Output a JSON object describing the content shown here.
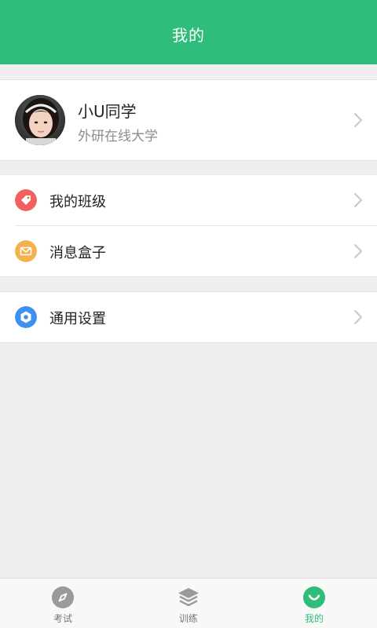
{
  "header": {
    "title": "我的"
  },
  "profile": {
    "name": "小U同学",
    "school": "外研在线大学"
  },
  "menu": {
    "items": [
      {
        "label": "我的班级",
        "icon": "tag-icon",
        "color": "#f0605d"
      },
      {
        "label": "消息盒子",
        "icon": "mail-icon",
        "color": "#f3b04f"
      },
      {
        "label": "通用设置",
        "icon": "settings-icon",
        "color": "#3d8ff0"
      }
    ]
  },
  "bottom_nav": {
    "items": [
      {
        "label": "考试",
        "icon": "compass-icon",
        "active": false
      },
      {
        "label": "训练",
        "icon": "layers-icon",
        "active": false
      },
      {
        "label": "我的",
        "icon": "profile-icon",
        "active": true
      }
    ]
  },
  "colors": {
    "brand": "#2ebd7b",
    "background": "#efefef"
  }
}
